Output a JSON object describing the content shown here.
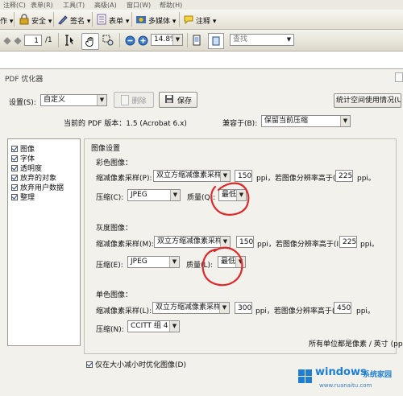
{
  "menubar": {
    "items": [
      "注释(C)",
      "表单(R)",
      "工具(T)",
      "高级(A)",
      "窗口(W)",
      "帮助(H)"
    ]
  },
  "toolbar1": {
    "work": "作 ▾",
    "security": "安全 ▾",
    "sign": "签名 ▾",
    "forms": "表单 ▾",
    "multimedia": "多媒体 ▾",
    "comment": "注释 ▾"
  },
  "toolbar2": {
    "page_current": "1",
    "page_total": "/1",
    "zoom": "14.8%",
    "find_placeholder": "查找"
  },
  "dialog": {
    "title": "PDF 优化器",
    "settings_label": "设置(S):",
    "settings_value": "自定义",
    "delete_label": "删除",
    "save_label": "保存",
    "audit_button": "统计空间使用情况(U)...",
    "version_label": "当前的 PDF 版本：1.5 (Acrobat 6.x)",
    "compat_label": "兼容于(B):",
    "compat_value": "保留当前压缩",
    "categories": [
      {
        "label": "图像",
        "checked": true
      },
      {
        "label": "字体",
        "checked": true
      },
      {
        "label": "透明度",
        "checked": true
      },
      {
        "label": "放弃的对象",
        "checked": true
      },
      {
        "label": "放弃用户数据",
        "checked": true
      },
      {
        "label": "整理",
        "checked": true
      }
    ],
    "image_settings": {
      "heading": "图像设置",
      "color": {
        "title": "彩色图像：",
        "downsample_label": "缩减像素采样(P):",
        "downsample_value": "双立方缩减像素采样至",
        "ppi_value": "150",
        "ppi_text": "ppi，若图像分辨率高于(F)",
        "above_value": "225",
        "above_unit": "ppi。",
        "compression_label": "压缩(C):",
        "compression_value": "JPEG",
        "quality_label": "质量(Q):",
        "quality_value": "最低"
      },
      "gray": {
        "title": "灰度图像：",
        "downsample_label": "缩减像素采样(M):",
        "downsample_value": "双立方缩减像素采样至",
        "ppi_value": "150",
        "ppi_text": "ppi，若图像分辨率高于(I)",
        "above_value": "225",
        "above_unit": "ppi。",
        "compression_label": "压缩(E):",
        "compression_value": "JPEG",
        "quality_label": "质量(L):",
        "quality_value": "最低"
      },
      "mono": {
        "title": "单色图像：",
        "downsample_label": "缩减像素采样(L):",
        "downsample_value": "双立方缩减像素采样至",
        "ppi_value": "300",
        "ppi_text": "ppi，若图像分辨率高于(R)",
        "above_value": "450",
        "above_unit": "ppi。",
        "compression_label": "压缩(N):",
        "compression_value": "CCITT 组 4"
      },
      "units_note": "所有单位都是像素 / 英寸 (ppi)。"
    },
    "optimize_checkbox": "仅在大小减小时优化图像(D)"
  },
  "watermark": {
    "brand": "windows",
    "suffix": "系统家园",
    "url": "www.ruanaitu.com"
  },
  "colors": {
    "annotation": "#e0282a",
    "accent": "#1a3d8f"
  }
}
